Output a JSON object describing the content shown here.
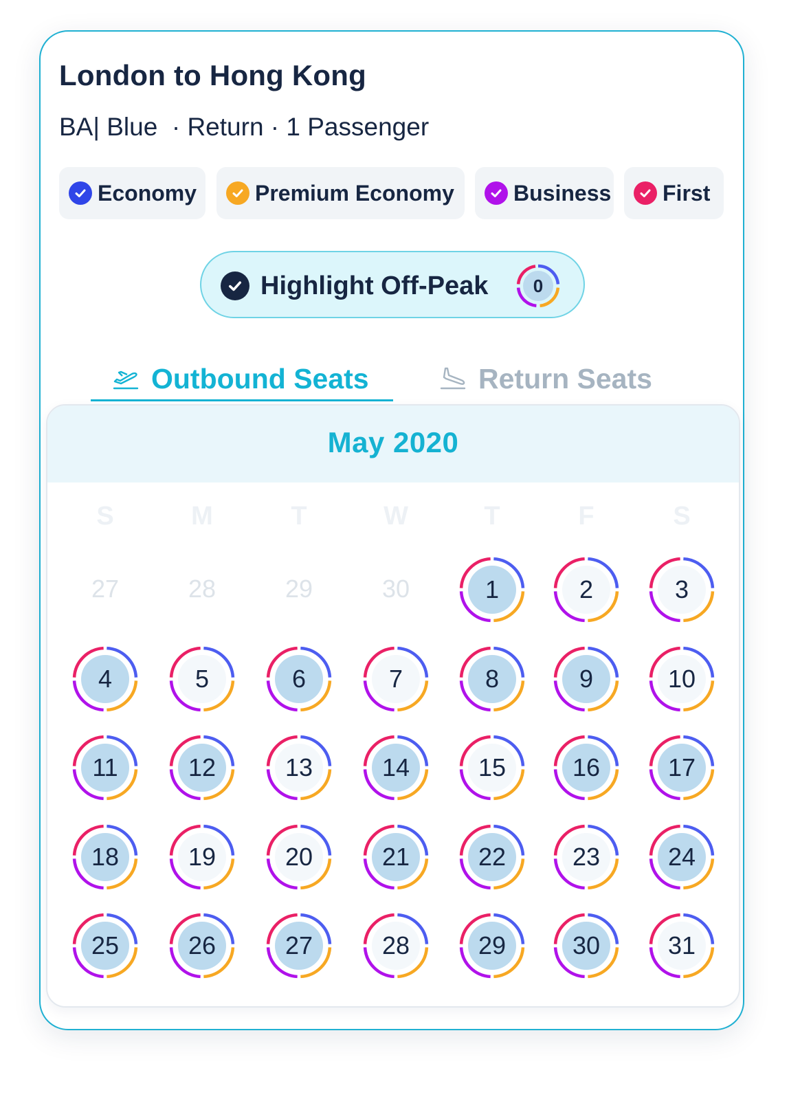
{
  "route_title": "London to Hong Kong",
  "subtitle": "BA| Blue  · Return · 1 Passenger",
  "cabin_filters": [
    {
      "label": "Economy",
      "color": "#2f45e8",
      "checked": true
    },
    {
      "label": "Premium Economy",
      "color": "#f7a823",
      "checked": true
    },
    {
      "label": "Business",
      "color": "#b012ea",
      "checked": true
    },
    {
      "label": "First",
      "color": "#ea2066",
      "checked": true
    }
  ],
  "off_peak_toggle": {
    "label": "Highlight Off-Peak",
    "count": "0",
    "checked": true
  },
  "tabs": {
    "outbound": "Outbound Seats",
    "return": "Return Seats",
    "active": "outbound"
  },
  "calendar": {
    "month": "May 2020",
    "weekdays": [
      "S",
      "M",
      "T",
      "W",
      "T",
      "F",
      "S"
    ],
    "prev_month_days": [
      "27",
      "28",
      "29",
      "30"
    ],
    "days": [
      {
        "day": "1",
        "off_peak": true
      },
      {
        "day": "2",
        "off_peak": false
      },
      {
        "day": "3",
        "off_peak": false
      },
      {
        "day": "4",
        "off_peak": true
      },
      {
        "day": "5",
        "off_peak": false
      },
      {
        "day": "6",
        "off_peak": true
      },
      {
        "day": "7",
        "off_peak": false
      },
      {
        "day": "8",
        "off_peak": true
      },
      {
        "day": "9",
        "off_peak": true
      },
      {
        "day": "10",
        "off_peak": false
      },
      {
        "day": "11",
        "off_peak": true
      },
      {
        "day": "12",
        "off_peak": true
      },
      {
        "day": "13",
        "off_peak": false
      },
      {
        "day": "14",
        "off_peak": true
      },
      {
        "day": "15",
        "off_peak": false
      },
      {
        "day": "16",
        "off_peak": true
      },
      {
        "day": "17",
        "off_peak": true
      },
      {
        "day": "18",
        "off_peak": true
      },
      {
        "day": "19",
        "off_peak": false
      },
      {
        "day": "20",
        "off_peak": false
      },
      {
        "day": "21",
        "off_peak": true
      },
      {
        "day": "22",
        "off_peak": true
      },
      {
        "day": "23",
        "off_peak": false
      },
      {
        "day": "24",
        "off_peak": true
      },
      {
        "day": "25",
        "off_peak": true
      },
      {
        "day": "26",
        "off_peak": true
      },
      {
        "day": "27",
        "off_peak": true
      },
      {
        "day": "28",
        "off_peak": false
      },
      {
        "day": "29",
        "off_peak": true
      },
      {
        "day": "30",
        "off_peak": true
      },
      {
        "day": "31",
        "off_peak": false
      }
    ]
  },
  "colors": {
    "accent": "#13b3d4",
    "economy": "#4d5df0",
    "premium_economy": "#f7a823",
    "business": "#b012ea",
    "first": "#ea2066",
    "off_peak_fill": "#bcdaee",
    "regular_fill": "#f4f8fb"
  }
}
